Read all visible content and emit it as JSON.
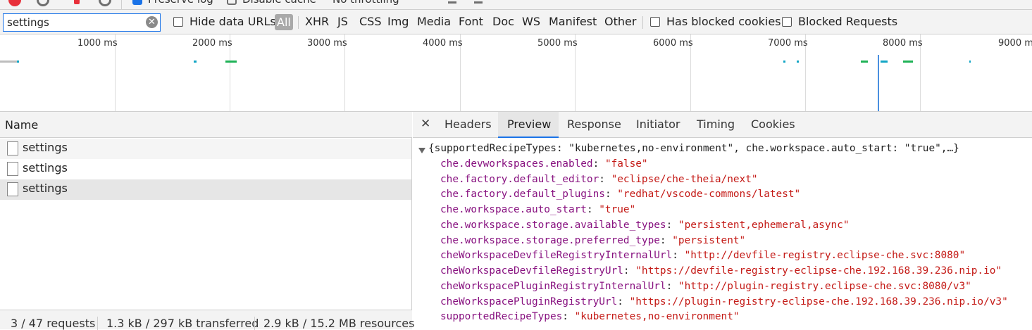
{
  "toolbar": {
    "preserve_log": "Preserve log",
    "disable_cache": "Disable cache",
    "throttling": "No throttling"
  },
  "filter": {
    "value": "settings",
    "hide_data_urls": "Hide data URLs",
    "all": "All",
    "types": [
      "XHR",
      "JS",
      "CSS",
      "Img",
      "Media",
      "Font",
      "Doc",
      "WS",
      "Manifest",
      "Other"
    ],
    "has_blocked_cookies": "Has blocked cookies",
    "blocked_requests": "Blocked Requests"
  },
  "overview": {
    "ticks": [
      "1000 ms",
      "2000 ms",
      "3000 ms",
      "4000 ms",
      "5000 ms",
      "6000 ms",
      "7000 ms",
      "8000 ms",
      "9000 ms"
    ]
  },
  "requests": {
    "header": "Name",
    "rows": [
      "settings",
      "settings",
      "settings"
    ],
    "selected_index": 2
  },
  "status": {
    "requests": "3 / 47 requests",
    "transferred": "1.3 kB / 297 kB transferred",
    "resources": "2.9 kB / 15.2 MB resources"
  },
  "details": {
    "tabs": [
      "Headers",
      "Preview",
      "Response",
      "Initiator",
      "Timing",
      "Cookies"
    ],
    "active_tab": "Preview",
    "summary": {
      "open": "{",
      "k1": "supportedRecipeTypes",
      "v1": "\"kubernetes,no-environment\"",
      "k2": "che.workspace.auto_start",
      "v2": "\"true\"",
      "tail": ",…}"
    },
    "props": [
      {
        "key": "che.devworkspaces.enabled",
        "value": "\"false\""
      },
      {
        "key": "che.factory.default_editor",
        "value": "\"eclipse/che-theia/next\""
      },
      {
        "key": "che.factory.default_plugins",
        "value": "\"redhat/vscode-commons/latest\""
      },
      {
        "key": "che.workspace.auto_start",
        "value": "\"true\""
      },
      {
        "key": "che.workspace.storage.available_types",
        "value": "\"persistent,ephemeral,async\""
      },
      {
        "key": "che.workspace.storage.preferred_type",
        "value": "\"persistent\""
      },
      {
        "key": "cheWorkspaceDevfileRegistryInternalUrl",
        "value": "\"http://devfile-registry.eclipse-che.svc:8080\""
      },
      {
        "key": "cheWorkspaceDevfileRegistryUrl",
        "value": "\"https://devfile-registry-eclipse-che.192.168.39.236.nip.io\""
      },
      {
        "key": "cheWorkspacePluginRegistryInternalUrl",
        "value": "\"http://plugin-registry.eclipse-che.svc:8080/v3\""
      },
      {
        "key": "cheWorkspacePluginRegistryUrl",
        "value": "\"https://plugin-registry-eclipse-che.192.168.39.236.nip.io/v3\""
      },
      {
        "key": "supportedRecipeTypes",
        "value": "\"kubernetes,no-environment\""
      }
    ]
  },
  "colors": {
    "accent": "#1a73e8",
    "key": "#881280",
    "string": "#c41a16",
    "bar_green": "#1fb257",
    "bar_cyan": "#12a5c5"
  }
}
